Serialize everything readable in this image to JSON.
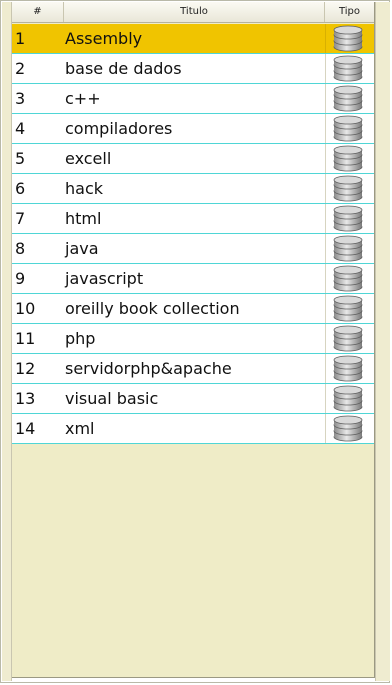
{
  "table": {
    "columns": {
      "num": "#",
      "title": "Titulo",
      "type": "Tipo"
    },
    "selected_index": 0,
    "type_icon": "database-stack-icon",
    "rows": [
      {
        "num": "1",
        "title": "Assembly"
      },
      {
        "num": "2",
        "title": "base de dados"
      },
      {
        "num": "3",
        "title": "c++"
      },
      {
        "num": "4",
        "title": "compiladores"
      },
      {
        "num": "5",
        "title": "excell"
      },
      {
        "num": "6",
        "title": "hack"
      },
      {
        "num": "7",
        "title": "html"
      },
      {
        "num": "8",
        "title": "java"
      },
      {
        "num": "9",
        "title": "javascript"
      },
      {
        "num": "10",
        "title": "oreilly book collection"
      },
      {
        "num": "11",
        "title": "php"
      },
      {
        "num": "12",
        "title": "servidorphp&apache"
      },
      {
        "num": "13",
        "title": "visual basic"
      },
      {
        "num": "14",
        "title": "xml"
      }
    ]
  },
  "colors": {
    "selection": "#f0c400",
    "row_separator": "#4fd6d6",
    "panel_background": "#efecc7"
  }
}
